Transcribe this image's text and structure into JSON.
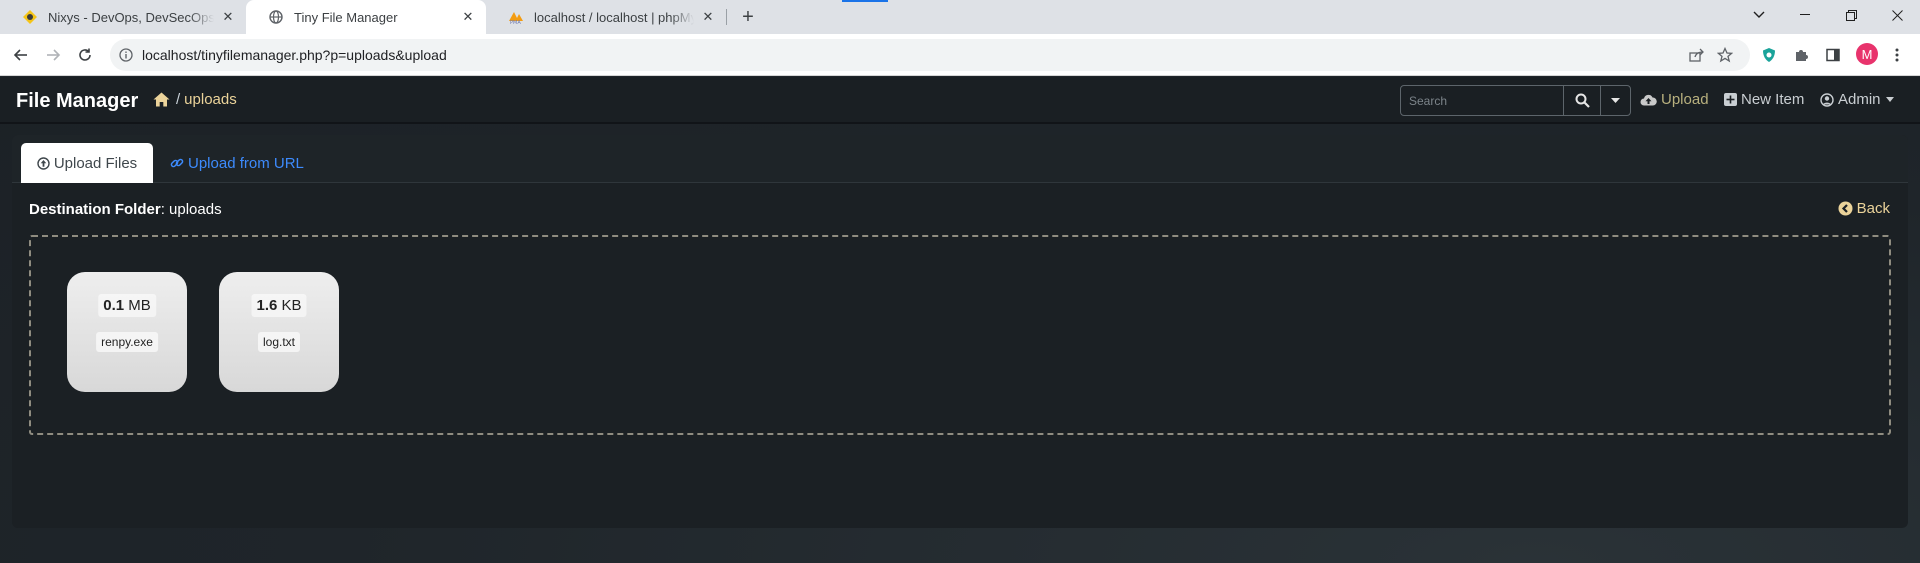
{
  "browser": {
    "tabs": [
      {
        "title": "Nixys - DevOps, DevSecOps, MLOps",
        "favicon": "nixys-logo-icon",
        "active": false
      },
      {
        "title": "Tiny File Manager",
        "favicon": "globe-icon",
        "active": true
      },
      {
        "title": "localhost / localhost | phpMyAdmin",
        "favicon": "phpmyadmin-logo-icon",
        "active": false
      }
    ],
    "url": "localhost/tinyfilemanager.php?p=uploads&upload",
    "profile_initial": "M",
    "colors": {
      "tabstrip": "#dee1e6",
      "avatar": "#e8336c"
    }
  },
  "app": {
    "brand": "File Manager",
    "breadcrumb": {
      "separator": "/",
      "folder": "uploads"
    },
    "search": {
      "placeholder": "Search",
      "value": ""
    },
    "nav": {
      "upload": "Upload",
      "new_item": "New Item",
      "admin": "Admin"
    },
    "colors": {
      "accent": "#ebd39a",
      "link": "#3d8bfd",
      "navbar": "#1a1f23"
    }
  },
  "upload_panel": {
    "tabs": {
      "upload_files": "Upload Files",
      "upload_from_url": "Upload from URL"
    },
    "destination_label": "Destination Folder",
    "destination_value": "uploads",
    "back_label": "Back",
    "files": [
      {
        "size": "0.1",
        "unit": "MB",
        "name": "renpy.exe"
      },
      {
        "size": "1.6",
        "unit": "KB",
        "name": "log.txt"
      }
    ]
  }
}
